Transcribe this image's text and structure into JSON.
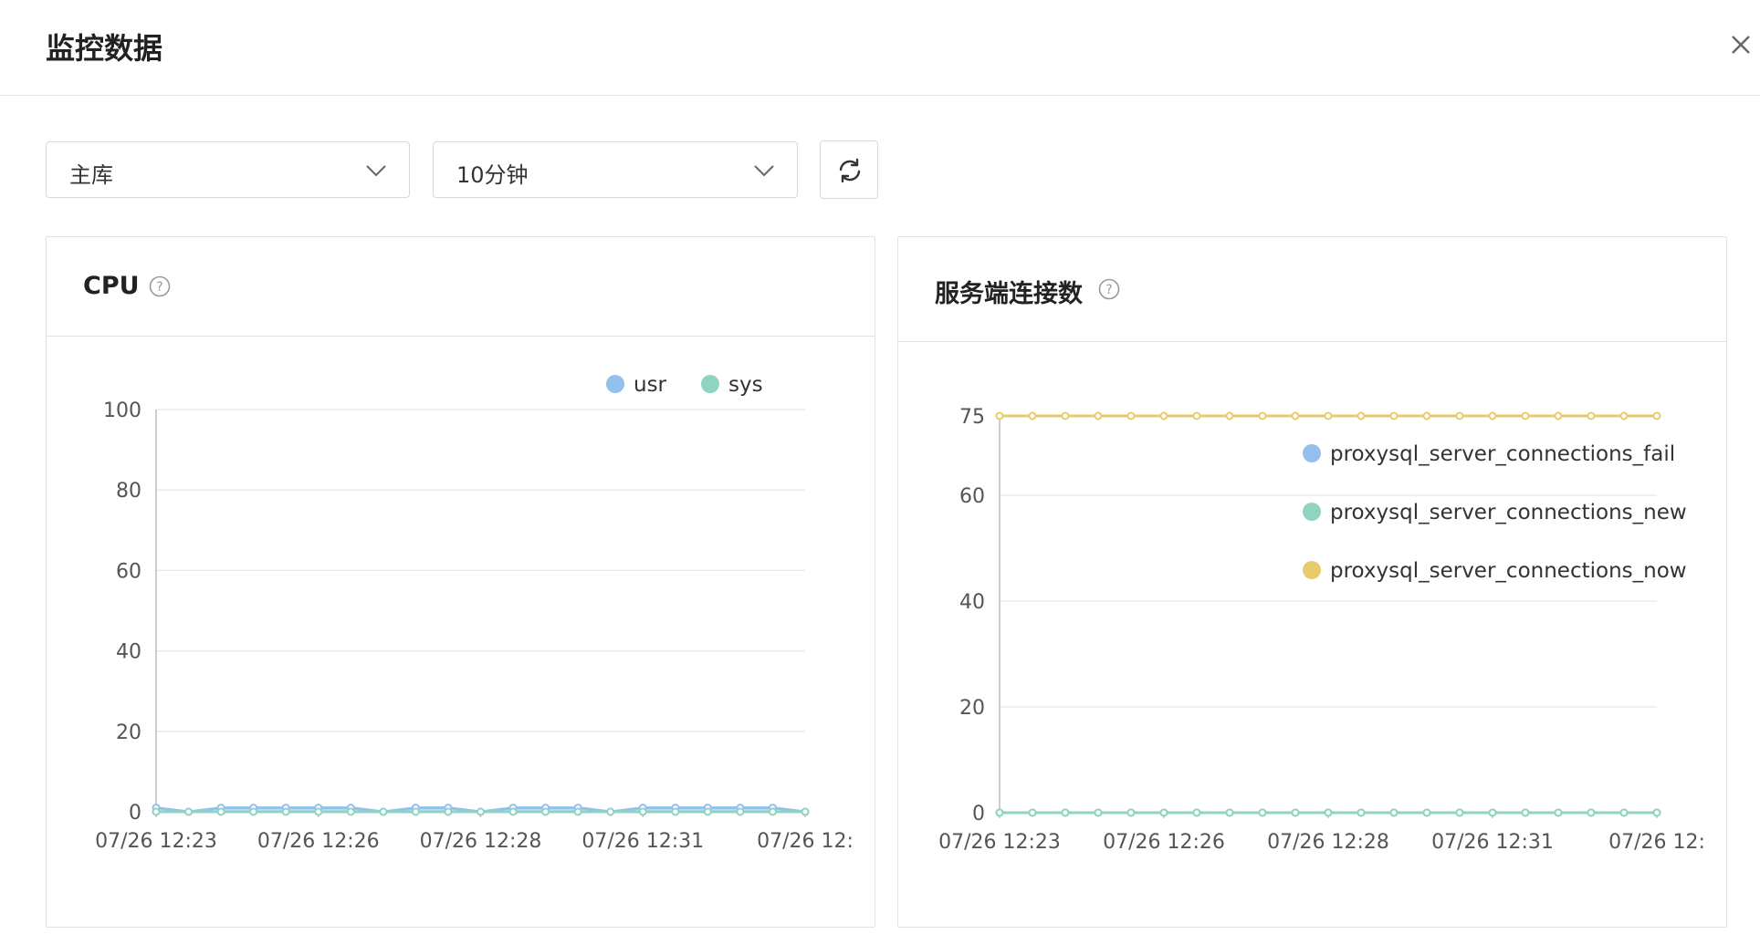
{
  "dialog": {
    "title": "监控数据"
  },
  "controls": {
    "instance_select": {
      "value": "主库"
    },
    "range_select": {
      "value": "10分钟"
    }
  },
  "charts": {
    "cpu": {
      "title": "CPU"
    },
    "conn": {
      "title": "服务端连接数"
    }
  },
  "chart_data": [
    {
      "type": "area",
      "title": "CPU",
      "categories": [
        "07/26 12:23",
        "07/26 12:26",
        "07/26 12:28",
        "07/26 12:31",
        "07/26 12:"
      ],
      "ylim": [
        0,
        100
      ],
      "yticks": [
        0,
        20,
        40,
        60,
        80,
        100
      ],
      "grid": true,
      "legend": "top-right",
      "series": [
        {
          "name": "usr",
          "color": "#93c0ec",
          "values": [
            1,
            0,
            1,
            1,
            1,
            1,
            1,
            0,
            1,
            1,
            0,
            1,
            1,
            1,
            0,
            1,
            1,
            1,
            1,
            1,
            0
          ]
        },
        {
          "name": "sys",
          "color": "#8fd3c2",
          "values": [
            0,
            0,
            0,
            0,
            0,
            0,
            0,
            0,
            0,
            0,
            0,
            0,
            0,
            0,
            0,
            0,
            0,
            0,
            0,
            0,
            0
          ]
        }
      ]
    },
    {
      "type": "line",
      "title": "服务端连接数",
      "categories": [
        "07/26 12:23",
        "07/26 12:26",
        "07/26 12:28",
        "07/26 12:31",
        "07/26 12:"
      ],
      "ylim": [
        0,
        75
      ],
      "yticks": [
        0,
        20,
        40,
        60,
        75
      ],
      "grid": true,
      "legend": "top-right",
      "series": [
        {
          "name": "proxysql_server_connections_fail",
          "color": "#93c0ec",
          "values": [
            0,
            0,
            0,
            0,
            0,
            0,
            0,
            0,
            0,
            0,
            0,
            0,
            0,
            0,
            0,
            0,
            0,
            0,
            0,
            0,
            0
          ]
        },
        {
          "name": "proxysql_server_connections_new",
          "color": "#8fd3c2",
          "values": [
            0,
            0,
            0,
            0,
            0,
            0,
            0,
            0,
            0,
            0,
            0,
            0,
            0,
            0,
            0,
            0,
            0,
            0,
            0,
            0,
            0
          ]
        },
        {
          "name": "proxysql_server_connections_now",
          "color": "#e6cc6c",
          "values": [
            75,
            75,
            75,
            75,
            75,
            75,
            75,
            75,
            75,
            75,
            75,
            75,
            75,
            75,
            75,
            75,
            75,
            75,
            75,
            75,
            75
          ]
        }
      ]
    }
  ]
}
